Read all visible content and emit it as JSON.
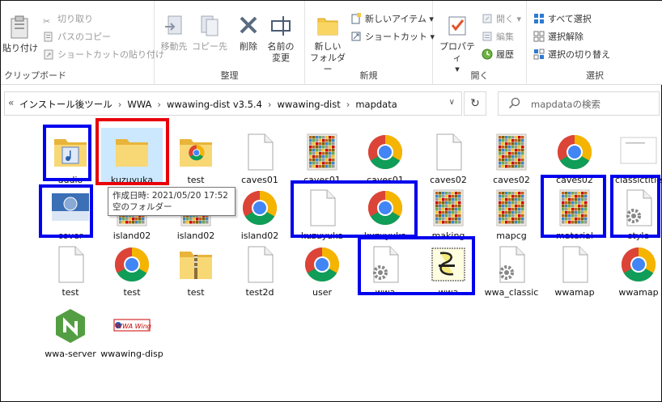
{
  "ribbon": {
    "clipboard": {
      "group_label": "クリップボード",
      "paste": "貼り付け",
      "cut": "切り取り",
      "copy_path": "パスのコピー",
      "paste_shortcut": "ショートカットの貼り付け"
    },
    "organize": {
      "group_label": "整理",
      "move_to": "移動先",
      "copy_to": "コピー先",
      "delete": "削除",
      "rename_line1": "名前の",
      "rename_line2": "変更"
    },
    "new": {
      "group_label": "新規",
      "new_folder_line1": "新しい",
      "new_folder_line2": "フォルダー",
      "new_item": "新しいアイテム",
      "shortcut": "ショートカット"
    },
    "open": {
      "group_label": "開く",
      "properties": "プロパティ",
      "open": "開く",
      "edit": "編集",
      "history": "履歴"
    },
    "select": {
      "group_label": "選択",
      "select_all": "すべて選択",
      "select_none": "選択解除",
      "invert_selection": "選択の切り替え"
    }
  },
  "address": {
    "crumbs": [
      "インストール後ツール",
      "WWA",
      "wwawing-dist v3.5.4",
      "wwawing-dist",
      "mapdata"
    ],
    "search_placeholder": "mapdataの検索"
  },
  "files": [
    {
      "name": "audio",
      "icon": "folder-media-icon"
    },
    {
      "name": "kuzuyuka",
      "icon": "folder-icon"
    },
    {
      "name": "test",
      "icon": "folder-chrome-icon"
    },
    {
      "name": "caves01",
      "icon": "blank-file-icon"
    },
    {
      "name": "caves01",
      "icon": "image-thumb-icon"
    },
    {
      "name": "caves01",
      "icon": "chrome-icon"
    },
    {
      "name": "caves02",
      "icon": "blank-file-icon"
    },
    {
      "name": "caves02",
      "icon": "image-thumb-icon"
    },
    {
      "name": "caves02",
      "icon": "chrome-icon"
    },
    {
      "name": "classictitle",
      "icon": "document-thumb-icon"
    },
    {
      "name": "cover",
      "icon": "cover-thumb-icon"
    },
    {
      "name": "island02",
      "icon": "image-thumb-icon"
    },
    {
      "name": "island02",
      "icon": "image-thumb-icon"
    },
    {
      "name": "island02",
      "icon": "chrome-icon"
    },
    {
      "name": "kuzuyuka",
      "icon": "blank-file-icon"
    },
    {
      "name": "kuzuyuka",
      "icon": "chrome-icon"
    },
    {
      "name": "making",
      "icon": "image-thumb-icon"
    },
    {
      "name": "mapcg",
      "icon": "image-thumb-icon"
    },
    {
      "name": "material",
      "icon": "image-thumb-icon"
    },
    {
      "name": "style",
      "icon": "settings-file-icon"
    },
    {
      "name": "test",
      "icon": "blank-file-icon"
    },
    {
      "name": "test",
      "icon": "chrome-icon"
    },
    {
      "name": "test",
      "icon": "zip-folder-icon"
    },
    {
      "name": "test2d",
      "icon": "blank-file-icon"
    },
    {
      "name": "user",
      "icon": "chrome-icon"
    },
    {
      "name": "wwa",
      "icon": "settings-file-icon"
    },
    {
      "name": "wwa",
      "icon": "script-icon"
    },
    {
      "name": "wwa_classic",
      "icon": "settings-file-icon"
    },
    {
      "name": "wwamap",
      "icon": "blank-file-icon"
    },
    {
      "name": "wwamap",
      "icon": "chrome-icon"
    },
    {
      "name": "wwa-server",
      "icon": "nodejs-icon"
    },
    {
      "name": "wwawing-disp",
      "icon": "wwa-logo-icon"
    }
  ],
  "tooltip": {
    "line1": "作成日時: 2021/05/20 17:52",
    "line2": "空のフォルダー"
  },
  "colors": {
    "highlight_blue": "#0000ee",
    "highlight_red": "#e8000a",
    "selection": "#cce8ff"
  }
}
